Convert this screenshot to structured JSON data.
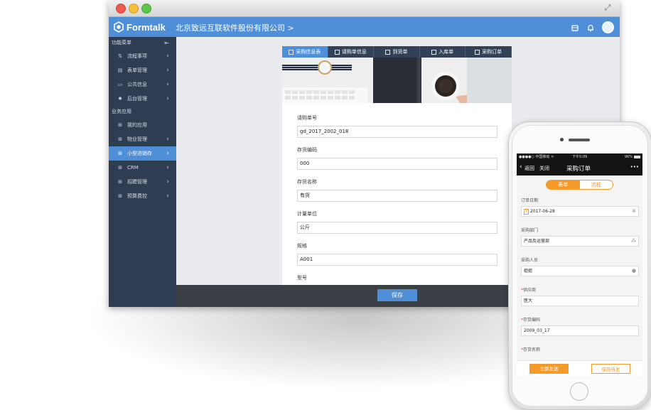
{
  "window": {
    "fullscreen_icon": "fullscreen-icon"
  },
  "app": {
    "logo_text": "Formtalk",
    "company": "北京致远互联软件股份有限公司 >"
  },
  "sidebar": {
    "section1": "功能菜单",
    "items1": [
      {
        "label": "流程事项",
        "icon": "flow-icon"
      },
      {
        "label": "表单管理",
        "icon": "form-icon"
      },
      {
        "label": "公共信息",
        "icon": "info-icon"
      },
      {
        "label": "后台管理",
        "icon": "gear-icon"
      }
    ],
    "section2": "业务应用",
    "items2": [
      {
        "label": "我的应用",
        "chevron": false
      },
      {
        "label": "物业管理",
        "chevron": true
      },
      {
        "label": "小型进销存",
        "chevron": true,
        "active": true
      },
      {
        "label": "CRM",
        "chevron": true
      },
      {
        "label": "招聘管理",
        "chevron": true
      },
      {
        "label": "预算费控",
        "chevron": true
      }
    ]
  },
  "form": {
    "tabs": [
      "采购信息表",
      "请购单信息",
      "到货单",
      "入库单",
      "采购订单"
    ],
    "fields": [
      {
        "label": "请购单号",
        "value": "gd_2017_2002_018"
      },
      {
        "label": "存货编码",
        "value": "000"
      },
      {
        "label": "存货名称",
        "value": "有货"
      },
      {
        "label": "计量单位",
        "value": "公斤"
      },
      {
        "label": "规格",
        "value": "A001"
      }
    ],
    "next_label": "型号",
    "save": "保存"
  },
  "phone": {
    "status_carrier": "●●●●○ 中国移动 ᯤ",
    "status_time": "下午5:09",
    "status_battery": "96%",
    "back": "返回",
    "close": "关闭",
    "title": "采购订单",
    "more": "•••",
    "seg_form": "表单",
    "seg_flow": "流程",
    "fields": [
      {
        "label": "订单日期",
        "value": "2017-06-28",
        "required": false
      },
      {
        "label": "采购部门",
        "value": "产品及运营部",
        "required": false
      },
      {
        "label": "采购人员",
        "value": "姐姐",
        "required": false
      },
      {
        "label": "供应商",
        "value": "医大",
        "required": true
      },
      {
        "label": "存货编码",
        "value": "2009_03_17",
        "required": true
      }
    ],
    "partial_label": "存货名称",
    "send_now": "立即发送",
    "save_draft": "保存待发"
  },
  "colors": {
    "brand": "#4f8fd8",
    "sidebar": "#2f3d52",
    "orange": "#f39a2b"
  }
}
